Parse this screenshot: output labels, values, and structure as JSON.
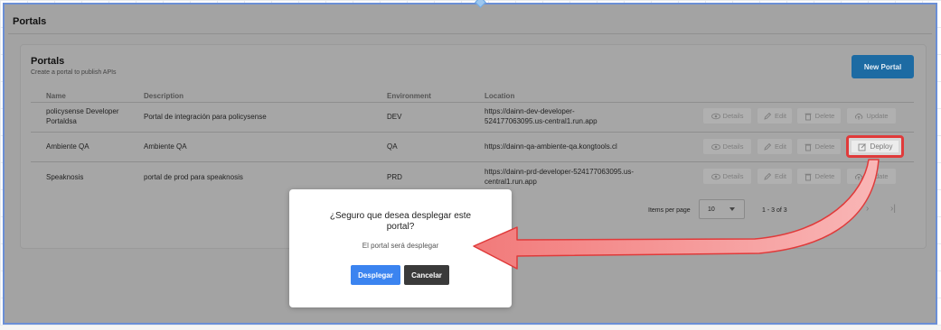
{
  "page": {
    "title": "Portals"
  },
  "card": {
    "title": "Portals",
    "subtitle": "Create a portal to publish APIs",
    "new_button": "New Portal"
  },
  "table": {
    "headers": [
      "Name",
      "Description",
      "Environment",
      "Location"
    ],
    "rows": [
      {
        "name": "policysense Developer Portaldsa",
        "description": "Portal de integración para policysense",
        "environment": "DEV",
        "location": "https://dainn-dev-developer-524177063095.us-central1.run.app",
        "last_action": "Update"
      },
      {
        "name": "Ambiente QA",
        "description": "Ambiente QA",
        "environment": "QA",
        "location": "https://dainn-qa-ambiente-qa.kongtools.cl",
        "last_action": "Deploy"
      },
      {
        "name": "Speaknosis",
        "description": "portal de prod para speaknosis",
        "environment": "PRD",
        "location": "https://dainn-prd-developer-524177063095.us-central1.run.app",
        "last_action": "Update"
      }
    ],
    "actions": {
      "details": "Details",
      "edit": "Edit",
      "delete": "Delete"
    }
  },
  "pagination": {
    "items_per_page_label": "Items per page",
    "items_per_page_value": "10",
    "range": "1 - 3 of 3"
  },
  "modal": {
    "title": "¿Seguro que desea desplegar este portal?",
    "text": "El portal será desplegar",
    "confirm": "Desplegar",
    "cancel": "Cancelar"
  },
  "annotation_color": "#e03a3a"
}
